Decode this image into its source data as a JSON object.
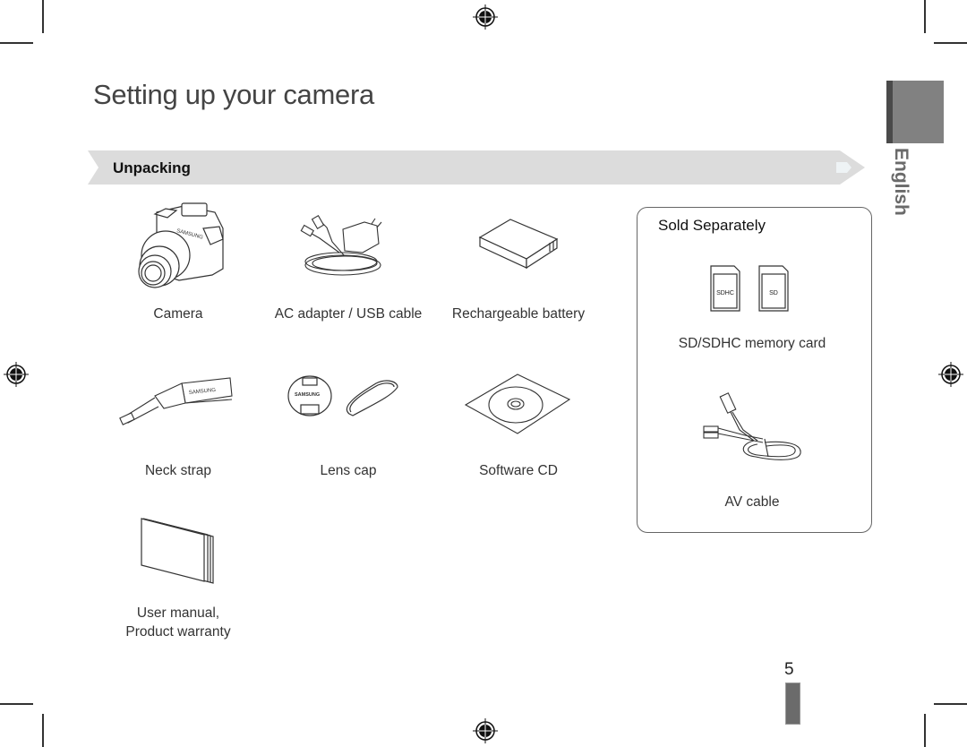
{
  "page": {
    "title": "Setting up your camera",
    "section_heading": "Unpacking",
    "language_tab": "English",
    "page_number": "5"
  },
  "included_items": [
    {
      "label": "Camera",
      "icon": "camera-icon"
    },
    {
      "label": "AC adapter / USB cable",
      "icon": "ac-adapter-icon"
    },
    {
      "label": "Rechargeable battery",
      "icon": "battery-icon"
    },
    {
      "label": "Neck strap",
      "icon": "neck-strap-icon"
    },
    {
      "label": "Lens cap",
      "icon": "lens-cap-icon"
    },
    {
      "label": "Software CD",
      "icon": "cd-icon"
    },
    {
      "label_line1": "User manual,",
      "label_line2": "Product warranty",
      "icon": "manual-icon"
    }
  ],
  "sold_separately": {
    "title": "Sold Separately",
    "items": [
      {
        "label": "SD/SDHC memory card",
        "icon": "memory-card-icon",
        "card_labels": [
          "SDHC",
          "SD"
        ]
      },
      {
        "label": "AV cable",
        "icon": "av-cable-icon"
      }
    ]
  },
  "strap_brand": "SAMSUNG",
  "lenscap_brand": "SAMSUNG",
  "colors": {
    "banner": "#dcdcdc",
    "language_block": "#818181",
    "text": "#333333"
  }
}
